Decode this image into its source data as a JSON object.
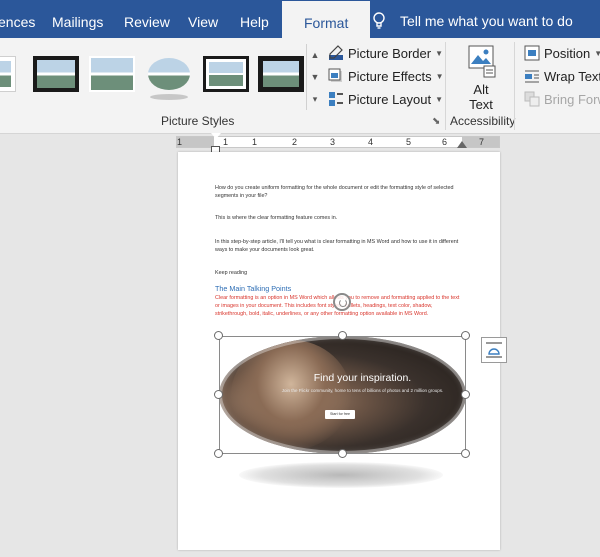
{
  "tabs": [
    {
      "label": "ences"
    },
    {
      "label": "Mailings"
    },
    {
      "label": "Review"
    },
    {
      "label": "View"
    },
    {
      "label": "Help"
    },
    {
      "label": "Format"
    }
  ],
  "tell_me": "Tell me what you want to do",
  "ribbon": {
    "picture_styles": {
      "group_label": "Picture Styles",
      "border_label": "Picture Border",
      "effects_label": "Picture Effects",
      "layout_label": "Picture Layout"
    },
    "accessibility": {
      "group_label": "Accessibility",
      "alt_text_line1": "Alt",
      "alt_text_line2": "Text"
    },
    "arrange": {
      "position_label": "Position",
      "wrap_text_label": "Wrap Text",
      "bring_forward_label": "Bring Forw"
    }
  },
  "ruler": {
    "ticks": [
      "1",
      "1",
      "1",
      "2",
      "3",
      "4",
      "5",
      "6",
      "7"
    ]
  },
  "document": {
    "para1": "How do you create uniform formatting for the whole document or edit the formatting style of selected segments in your file?",
    "para2": "This is where the clear formatting feature comes in.",
    "para3": "In this step-by-step article, I'll tell you what is clear formatting in MS Word and how to use it in different ways to make your documents look great.",
    "para4": "Keep reading",
    "heading": "The Main Talking Points",
    "red_para": "Clear formatting is an option in MS Word which allows you to remove and formatting applied to the text or images in your document. This includes font styles, bullets, headings, text color, shadow, strikethrough, bold, italic, underlines, or any other formatting option available in MS Word."
  },
  "picture": {
    "title": "Find your inspiration.",
    "subtitle": "Join the Flickr community, home to tens of billions of photos and 2 million groups.",
    "button": "Start for free"
  }
}
